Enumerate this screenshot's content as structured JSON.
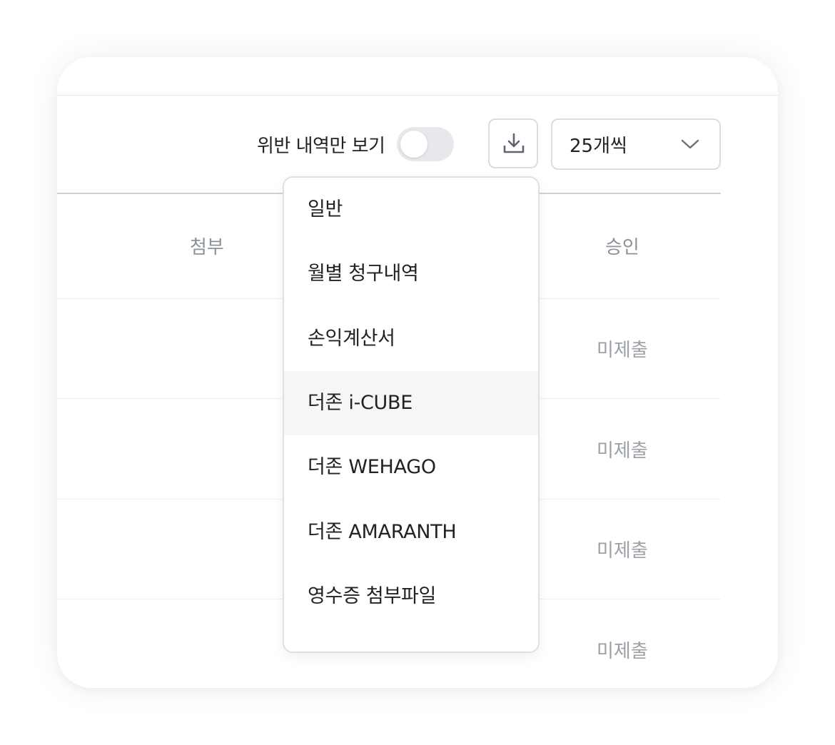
{
  "toolbar": {
    "violation_toggle_label": "위반 내역만 보기",
    "violation_toggle_on": false,
    "page_size_value": "25개씩"
  },
  "table": {
    "headers": {
      "attach": "첨부",
      "approve": "승인"
    },
    "rows": [
      {
        "approve": "미제출"
      },
      {
        "approve": "미제출"
      },
      {
        "approve": "미제출"
      },
      {
        "approve": "미제출"
      }
    ]
  },
  "download_menu": {
    "items": [
      {
        "label": "일반"
      },
      {
        "label": "월별 청구내역"
      },
      {
        "label": "손익계산서"
      },
      {
        "label": "더존 i-CUBE",
        "highlighted": true
      },
      {
        "label": "더존 WEHAGO"
      },
      {
        "label": "더존 AMARANTH"
      },
      {
        "label": "영수증 첨부파일"
      }
    ]
  },
  "icons": {
    "download": "download-icon",
    "dropdown": "chevron-down-icon"
  }
}
